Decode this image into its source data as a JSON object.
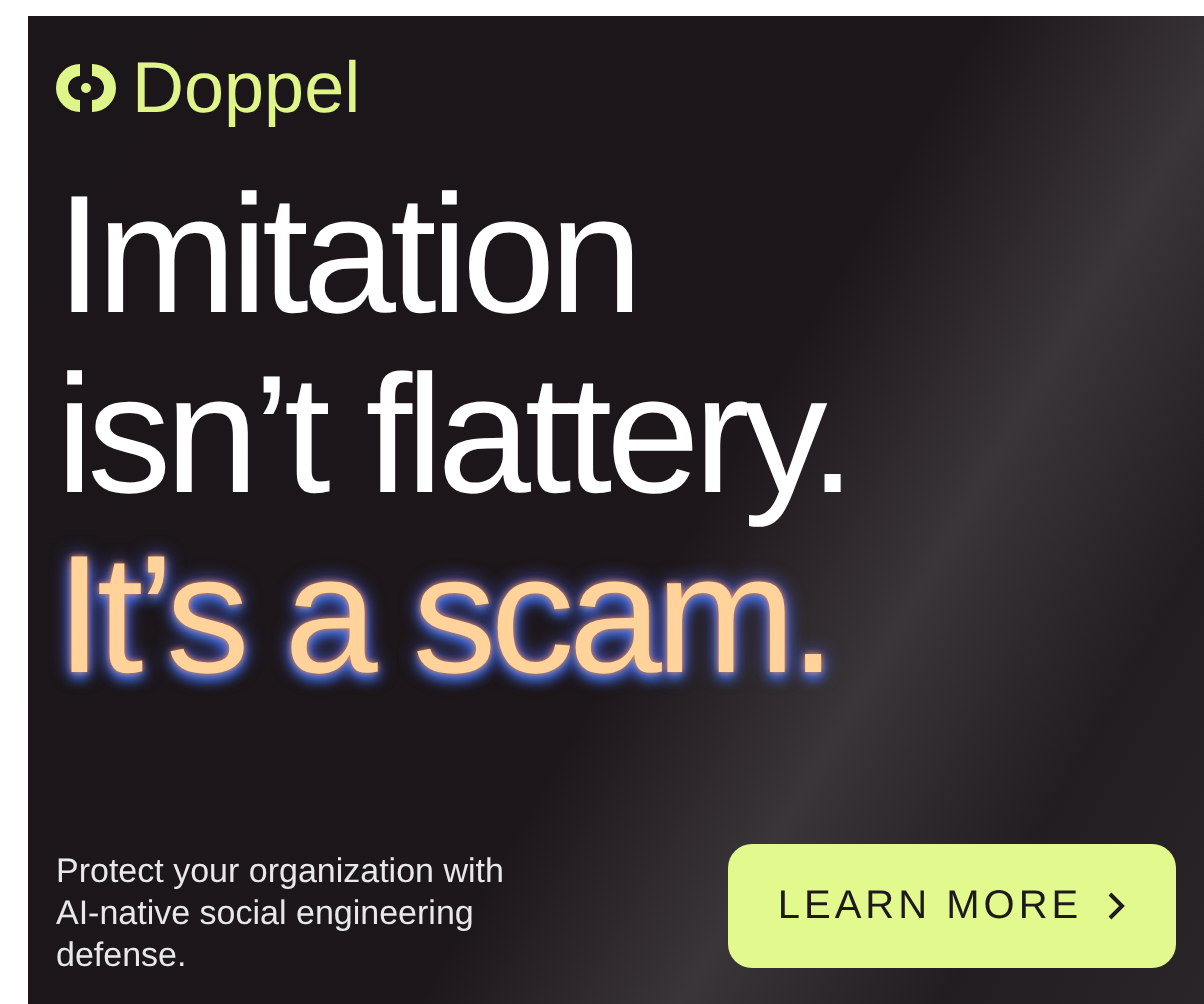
{
  "brand": {
    "name": "Doppel"
  },
  "headline": [
    "Imitation",
    "isn’t flattery."
  ],
  "highlight": "It’s a scam.",
  "body": "Protect your organization with AI-native social engineering defense.",
  "cta": {
    "label": "LEARN MORE"
  }
}
